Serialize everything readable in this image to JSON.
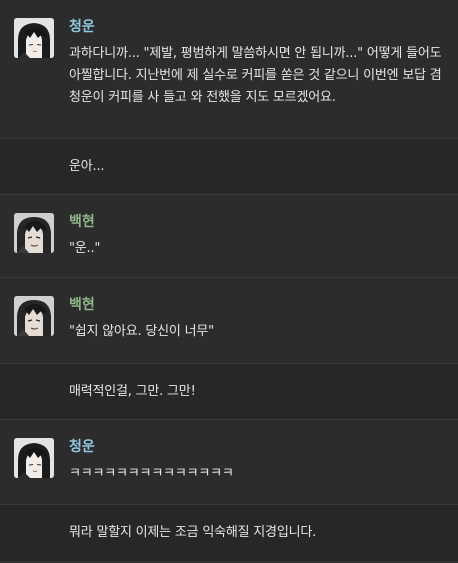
{
  "colors": {
    "background": "#2a2a2a",
    "divider": "#3a3a3a",
    "message_text": "#e6e6e6",
    "author_cheongun": "#8fc8e0",
    "author_baekhyeon": "#8fb58a"
  },
  "messages": [
    {
      "author": "청운",
      "avatar": "cheongun-avatar",
      "text": "과하다니까... \"제발, 평범하게 말씀하시면 안 됩니까...\" 어떻게 들어도 아찔합니다. 지난번에 제 실수로 커피를 쏟은 것 같으니 이번엔 보답 겸 청운이 커피를 사 들고 와 전했을 지도 모르겠어요."
    },
    {
      "text": "운아..."
    },
    {
      "author": "백현",
      "avatar": "baekhyeon-avatar",
      "text": "\"운..\""
    },
    {
      "author": "백현",
      "avatar": "baekhyeon-avatar",
      "text": "\"쉽지 않아요. 당신이 너무\""
    },
    {
      "text": "매력적인걸, 그만. 그만!"
    },
    {
      "author": "청운",
      "avatar": "cheongun-avatar",
      "text": "ㅋㅋㅋㅋㅋㅋㅋㅋㅋㅋㅋㅋㅋㅋ"
    },
    {
      "text": "뭐라 말할지 이제는 조금 익숙해질 지경입니다."
    }
  ]
}
